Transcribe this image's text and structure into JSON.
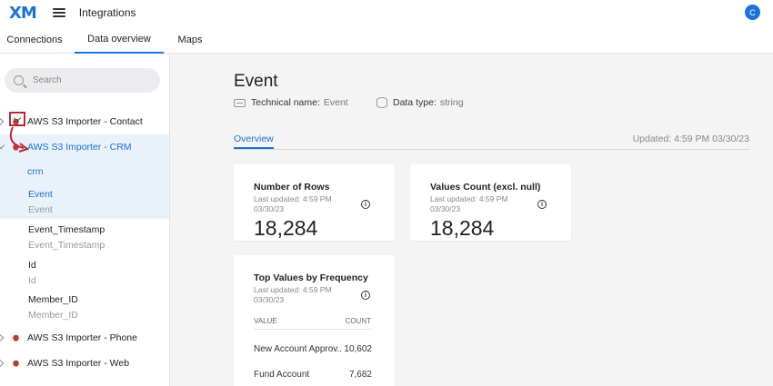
{
  "topbar": {
    "logo": "XM",
    "title": "Integrations",
    "user_initial": "C"
  },
  "tabs": [
    {
      "label": "Connections"
    },
    {
      "label": "Data overview"
    },
    {
      "label": "Maps"
    }
  ],
  "sidebar": {
    "search_placeholder": "Search",
    "items": [
      {
        "label": "AWS S3 Importer - Contact"
      },
      {
        "label": "AWS S3 Importer - CRM"
      },
      {
        "label": "crm"
      },
      {
        "label": "Event",
        "sub": "Event"
      },
      {
        "label": "Event_Timestamp",
        "sub": "Event_Timestamp"
      },
      {
        "label": "Id",
        "sub": "Id"
      },
      {
        "label": "Member_ID",
        "sub": "Member_ID"
      },
      {
        "label": "AWS S3 Importer - Phone"
      },
      {
        "label": "AWS S3 Importer - Web"
      }
    ]
  },
  "main": {
    "title": "Event",
    "technical_name_label": "Technical name:",
    "technical_name_value": "Event",
    "data_type_label": "Data type:",
    "data_type_value": "string",
    "overview_tab": "Overview",
    "updated": "Updated: 4:59 PM 03/30/23",
    "cards": [
      {
        "title": "Number of Rows",
        "sub": "Last updated: 4:59 PM 03/30/23",
        "value": "18,284"
      },
      {
        "title": "Values Count (excl. null)",
        "sub": "Last updated: 4:59 PM 03/30/23",
        "value": "18,284"
      }
    ],
    "top_values": {
      "title": "Top Values by Frequency",
      "sub": "Last updated: 4:59 PM 03/30/23",
      "col_value": "VALUE",
      "col_count": "COUNT",
      "rows": [
        {
          "name": "New Account Approv..",
          "count": "10,602"
        },
        {
          "name": "Fund Account",
          "count": "7,682"
        }
      ]
    }
  },
  "colors": {
    "accent": "#1a73d9",
    "annotation": "#b8283a",
    "selected_bg": "#e9f1fb",
    "node_icon": "#c0392b"
  }
}
